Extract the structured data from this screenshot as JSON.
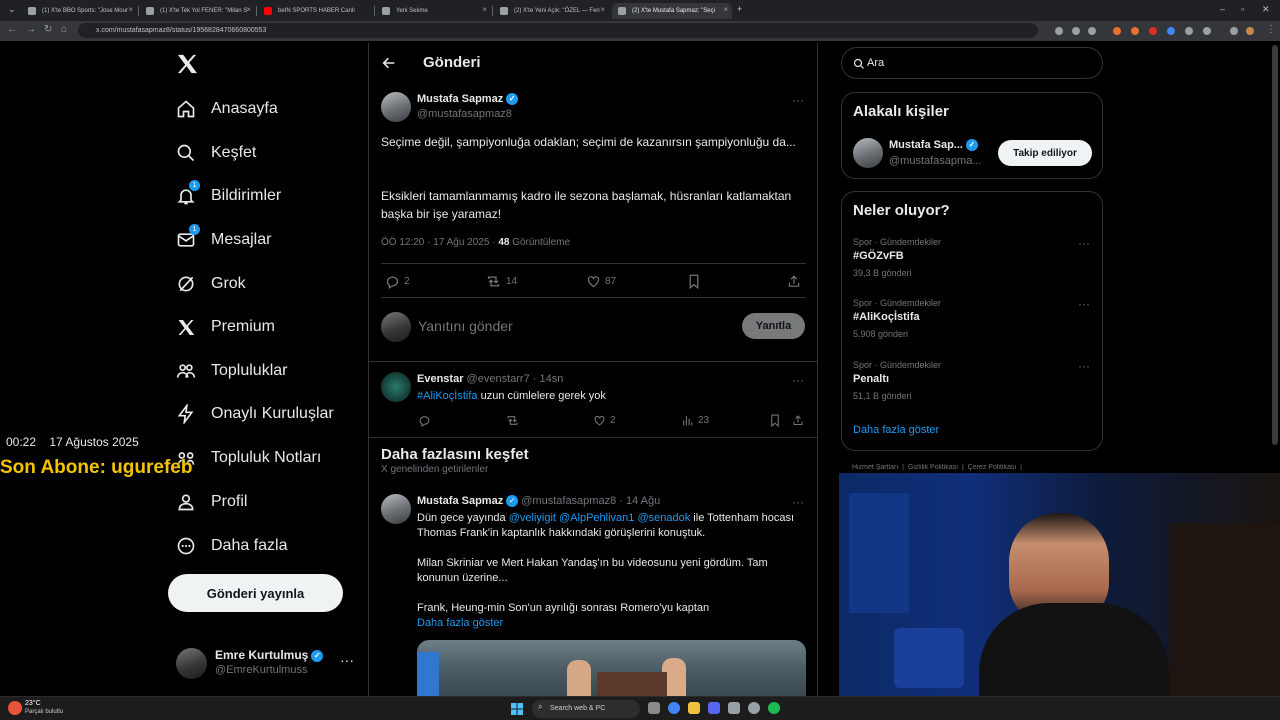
{
  "browser": {
    "tabs": [
      {
        "label": "(1) X'te BBO Sports: \"Jose Mour"
      },
      {
        "label": "(1) X'te Tek Yol FENER: \"Milan S"
      },
      {
        "label": "beIN SPORTS HABER Canlı"
      },
      {
        "label": "Yeni Sekme"
      },
      {
        "label": "(2) X'te Yeni Açık: \"ÖZEL — Fen"
      },
      {
        "label": "(2) X'te Mustafa Sapmaz: \"Seçi"
      }
    ],
    "url": "x.com/mustafasapmaz8/status/1956828470660800553"
  },
  "nav": {
    "items": [
      {
        "label": "Anasayfa"
      },
      {
        "label": "Keşfet"
      },
      {
        "label": "Bildirimler",
        "badge": "1"
      },
      {
        "label": "Mesajlar",
        "badge": "1"
      },
      {
        "label": "Grok"
      },
      {
        "label": "Premium"
      },
      {
        "label": "Topluluklar"
      },
      {
        "label": "Onaylı Kuruluşlar"
      },
      {
        "label": "Topluluk Notları"
      },
      {
        "label": "Profil"
      },
      {
        "label": "Daha fazla"
      }
    ],
    "post_button": "Gönderi yayınla",
    "account": {
      "name": "Emre Kurtulmuş",
      "handle": "@EmreKurtulmuss",
      "more": "···"
    }
  },
  "main": {
    "header_title": "Gönderi",
    "tweet": {
      "name": "Mustafa Sapmaz",
      "handle": "@mustafasapmaz8",
      "more": "···",
      "text1": "Seçime değil, şampiyonluğa odaklan; seçimi de kazanırsın şampiyonluğu da...",
      "text2": "Eksikleri tamamlanmamış kadro ile sezona başlamak, hüsranları katlamaktan başka bir işe yaramaz!",
      "time": "ÖÖ 12:20 · 17 Ağu 2025 · ",
      "views": "48",
      "views_label": " Görüntüleme",
      "replies": "2",
      "retweets": "14",
      "likes": "87"
    },
    "reply_box": {
      "placeholder": "Yanıtını gönder",
      "button": "Yanıtla"
    },
    "reply": {
      "name": "Evenstar",
      "handle": "@evenstarr7 · 14sn",
      "hashtag": "#AliKoçİstifa",
      "text": " uzun cümlelere gerek yok",
      "likes": "2",
      "views": "23",
      "more": "···"
    },
    "discover": {
      "title": "Daha fazlasını keşfet",
      "subtitle": "X genelinden getirilenler"
    },
    "tweet2": {
      "name": "Mustafa Sapmaz",
      "handle": "@mustafasapmaz8 · 14 Ağu",
      "more": "···",
      "line1_pre": "Dün gece yayında ",
      "mention1": "@veliyigit",
      "mention2": "@AlpPehlivan1",
      "mention3": "@senadok",
      "line1_post": " ile Tottenham hocası Thomas Frank'in kaptanlık hakkındaki görüşlerini konuştuk.",
      "para2": "Milan Skriniar ve Mert Hakan Yandaş'ın bu videosunu yeni gördüm. Tam konunun üzerine...",
      "para3": "Frank, Heung-min Son'un ayrılığı sonrası Romero'yu kaptan",
      "show_more": "Daha fazla göster"
    }
  },
  "right": {
    "search_placeholder": "Ara",
    "relevant": {
      "title": "Alakalı kişiler",
      "name": "Mustafa Sap...",
      "handle": "@mustafasapma...",
      "follow": "Takip ediliyor"
    },
    "trends": {
      "title": "Neler oluyor?",
      "items": [
        {
          "meta": "Spor · Gündemdekiler",
          "name": "#GÖZvFB",
          "count": "39,3 B gönderi"
        },
        {
          "meta": "Spor · Gündemdekiler",
          "name": "#AliKoçİstifa",
          "count": "5.908 gönderi"
        },
        {
          "meta": "Spor · Gündemdekiler",
          "name": "Penaltı",
          "count": "51,1 B gönderi"
        }
      ],
      "more": "···",
      "show_more": "Daha fazla göster"
    },
    "footer_partial": "Hizmet Şartları  |  Gizlilik Politikası  |  Çerez Politikası  |"
  },
  "overlay": {
    "time": "00:22",
    "date": "17 Ağustos 2025",
    "subscriber": "Son Abone: ugurefeb"
  },
  "taskbar": {
    "weather_temp": "23°C",
    "weather_desc": "Parçalı bulutlu",
    "search": "Search web & PC"
  }
}
